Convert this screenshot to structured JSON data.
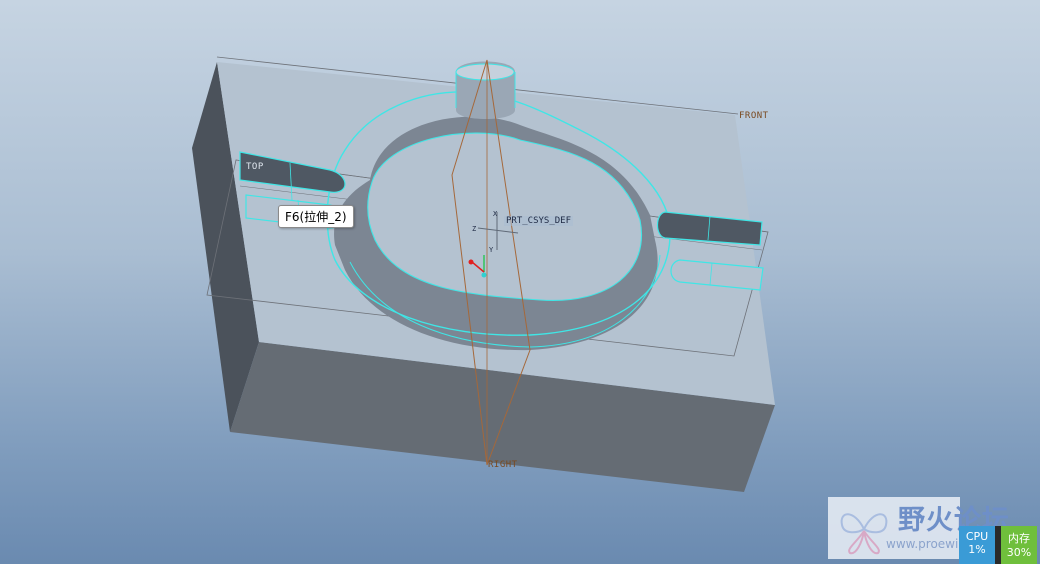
{
  "viewport": {
    "datum_planes": {
      "front": "FRONT",
      "top": "TOP",
      "right": "RIGHT"
    },
    "csys_label": "PRT_CSYS_DEF",
    "axis_letters": {
      "x": "X",
      "y": "Y",
      "z": "Z"
    }
  },
  "tooltip": {
    "text": "F6(拉伸_2)"
  },
  "watermark": {
    "title": "野火论坛",
    "url": "www.proewildfire.cn"
  },
  "system_monitor": {
    "cpu": {
      "label": "CPU",
      "value": "1%"
    },
    "memory": {
      "label": "内存",
      "value": "30%"
    }
  },
  "colors": {
    "highlight": "#3fe6e6",
    "datum": "#a5683a",
    "body_top": "#b3c1cf",
    "body_front": "#636b74",
    "body_side": "#4d545d"
  }
}
